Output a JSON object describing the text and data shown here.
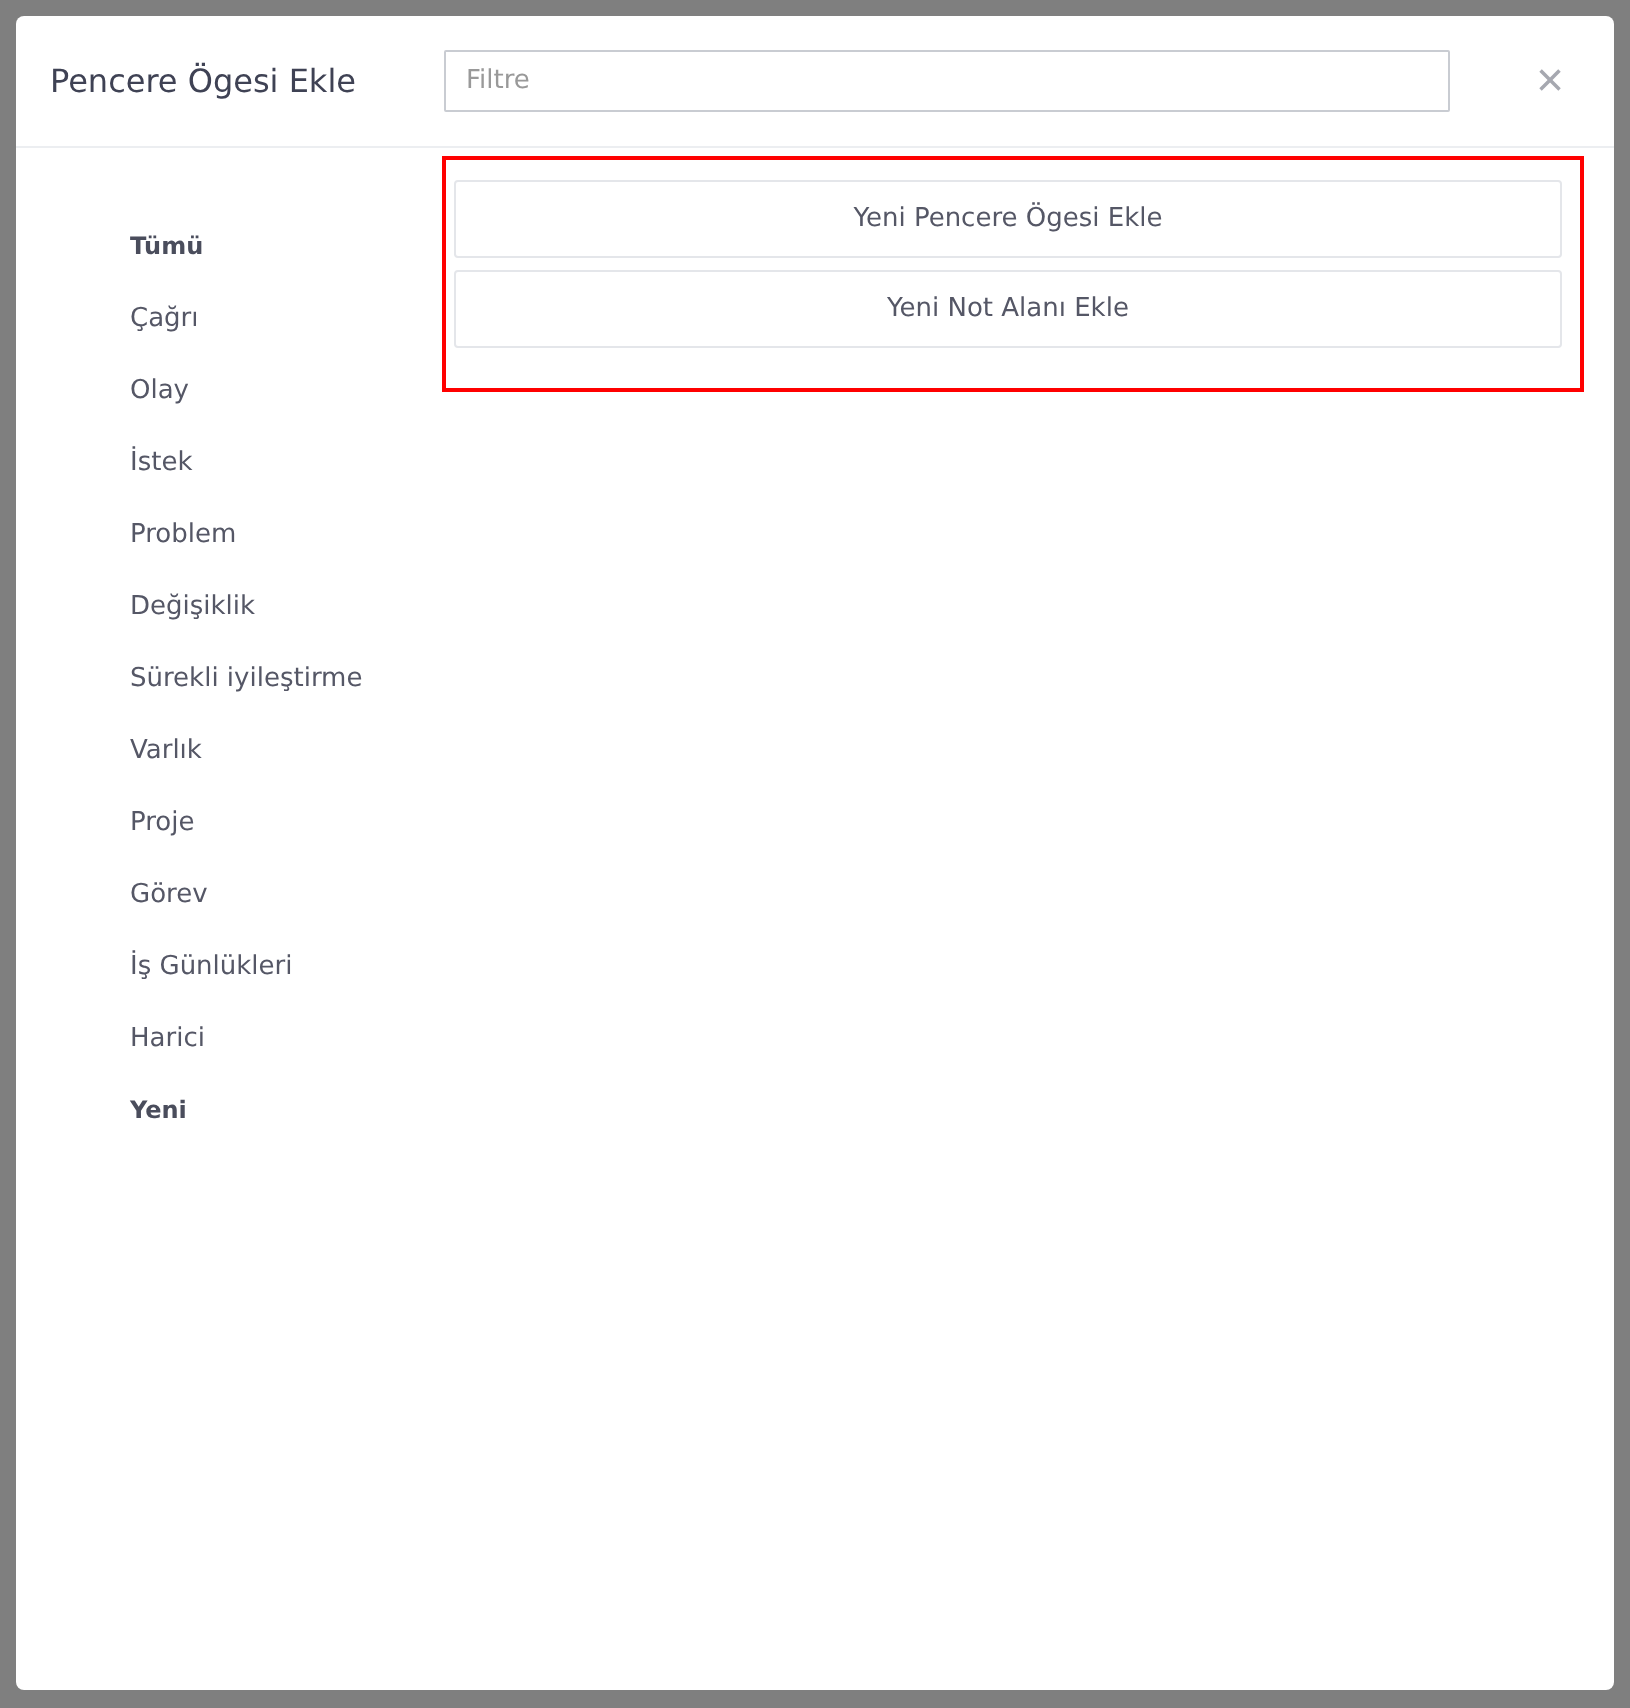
{
  "dialog": {
    "title": "Pencere Ögesi Ekle",
    "close": "×"
  },
  "filter": {
    "placeholder": "Filtre"
  },
  "categories": [
    {
      "label": "Tümü",
      "kind": "header"
    },
    {
      "label": "Çağrı",
      "kind": "item"
    },
    {
      "label": "Olay",
      "kind": "item"
    },
    {
      "label": "İstek",
      "kind": "item"
    },
    {
      "label": "Problem",
      "kind": "item"
    },
    {
      "label": "Değişiklik",
      "kind": "item"
    },
    {
      "label": "Sürekli iyileştirme",
      "kind": "item"
    },
    {
      "label": "Varlık",
      "kind": "item"
    },
    {
      "label": "Proje",
      "kind": "item"
    },
    {
      "label": "Görev",
      "kind": "item"
    },
    {
      "label": "İş Günlükleri",
      "kind": "item"
    },
    {
      "label": "Harici",
      "kind": "item"
    },
    {
      "label": "Yeni",
      "kind": "header"
    }
  ],
  "options": {
    "highlighted": true,
    "items": [
      "Yeni Pencere Ögesi Ekle",
      "Yeni Not Alanı Ekle"
    ]
  }
}
